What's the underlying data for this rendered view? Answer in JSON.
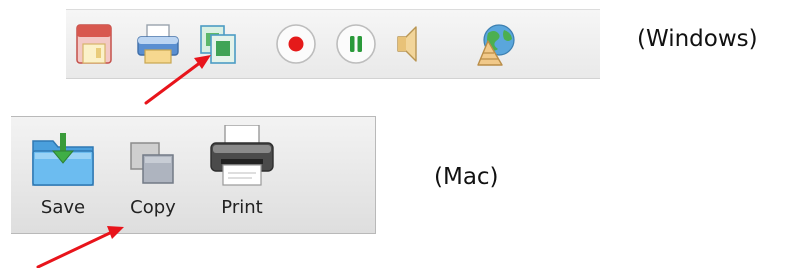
{
  "windows": {
    "label": "(Windows)",
    "buttons": [
      {
        "icon": "save-icon"
      },
      {
        "icon": "print-icon"
      },
      {
        "icon": "copy-icon"
      },
      {
        "icon": "record-icon"
      },
      {
        "icon": "pause-icon"
      },
      {
        "icon": "speaker-icon"
      },
      {
        "icon": "globe-icon"
      }
    ]
  },
  "mac": {
    "label": "(Mac)",
    "buttons": [
      {
        "icon": "save-icon",
        "label": "Save"
      },
      {
        "icon": "copy-icon",
        "label": "Copy"
      },
      {
        "icon": "print-icon",
        "label": "Print"
      }
    ]
  },
  "colors": {
    "arrow": "#e8141b",
    "record": "#e51a1a",
    "pause": "#2a9a3a",
    "mac_folder": "#5ab0e6"
  }
}
